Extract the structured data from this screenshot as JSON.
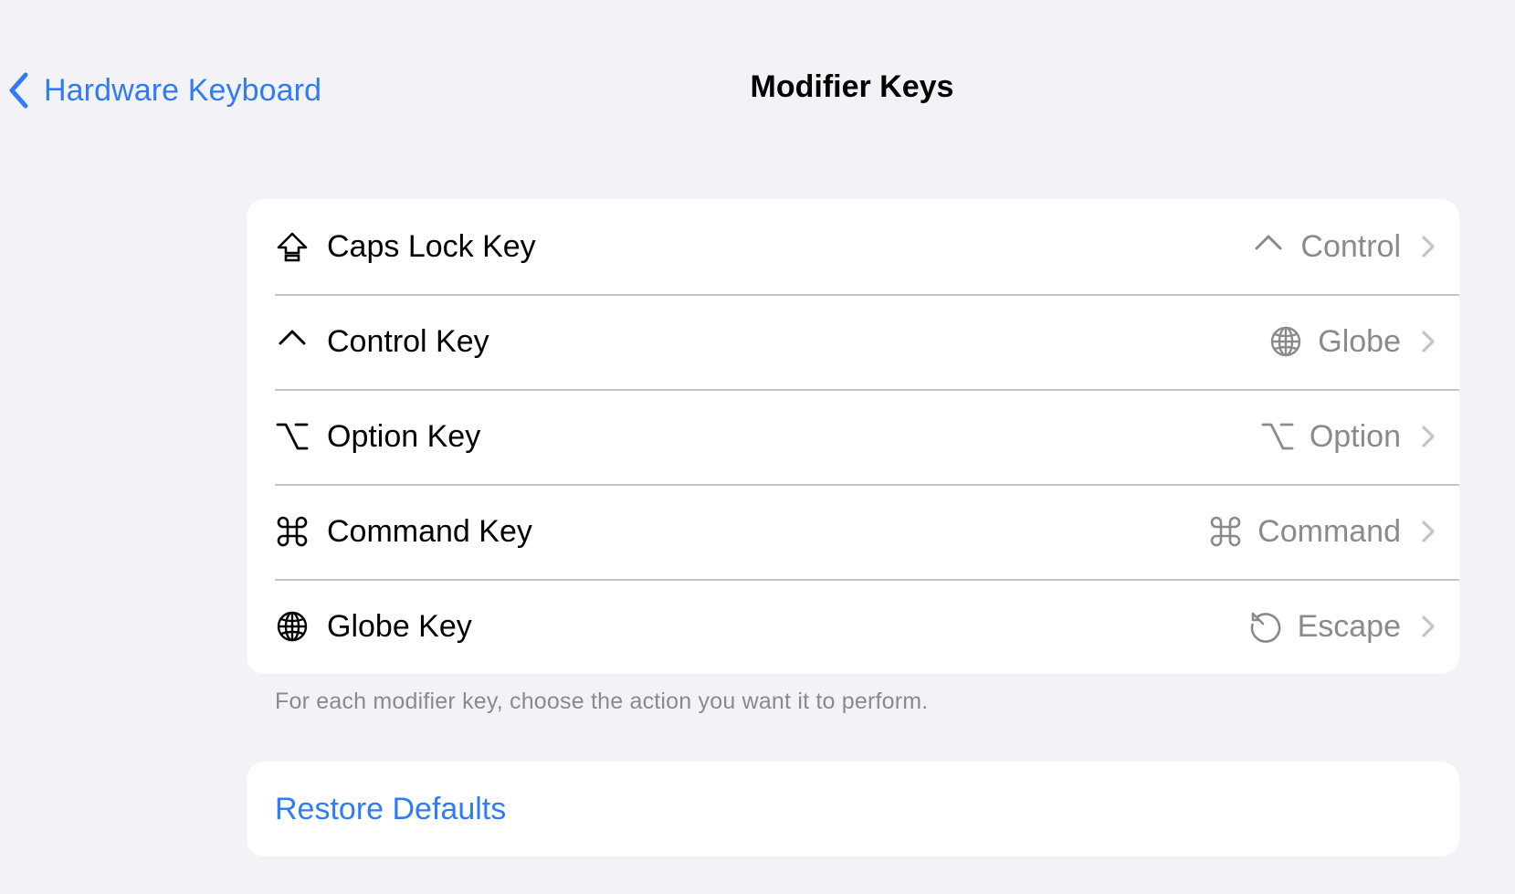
{
  "nav": {
    "back_label": "Hardware Keyboard",
    "title": "Modifier Keys"
  },
  "modifier_keys": [
    {
      "label": "Caps Lock Key",
      "icon": "caps-lock-icon",
      "value": "Control",
      "value_icon": "control-icon"
    },
    {
      "label": "Control Key",
      "icon": "control-icon",
      "value": "Globe",
      "value_icon": "globe-icon"
    },
    {
      "label": "Option Key",
      "icon": "option-icon",
      "value": "Option",
      "value_icon": "option-icon"
    },
    {
      "label": "Command Key",
      "icon": "command-icon",
      "value": "Command",
      "value_icon": "command-icon"
    },
    {
      "label": "Globe Key",
      "icon": "globe-icon",
      "value": "Escape",
      "value_icon": "escape-icon"
    }
  ],
  "footnote": "For each modifier key, choose the action you want it to perform.",
  "restore_label": "Restore Defaults",
  "colors": {
    "accent": "#2f7cf6",
    "background": "#f2f2f7",
    "secondary_text": "#8a8a8e",
    "separator": "#c6c6c8"
  }
}
